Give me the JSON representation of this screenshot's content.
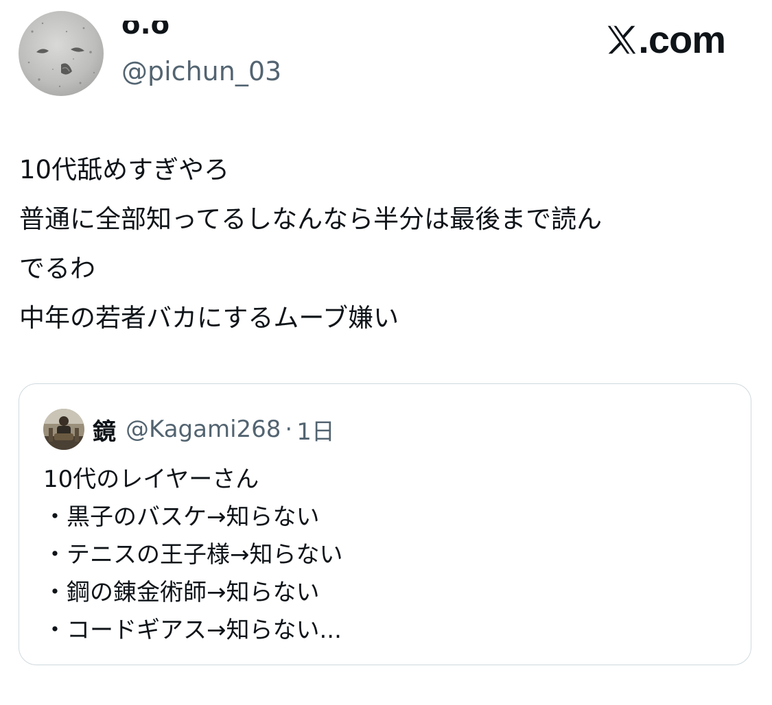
{
  "author": {
    "display_name": "o.o",
    "handle": "@pichun_03",
    "avatar_icon": "stone-face-avatar"
  },
  "site": {
    "brand_suffix": ".com",
    "logo_icon": "x-logo-icon"
  },
  "tweet": {
    "lines": [
      "10代舐めすぎやろ",
      "普通に全部知ってるしなんなら半分は最後まで読ん",
      "でるわ",
      "中年の若者バカにするムーブ嫌い"
    ]
  },
  "quote": {
    "name": "鏡",
    "handle": "@Kagami268",
    "separator": "·",
    "time": "1日",
    "avatar_icon": "person-photo-avatar",
    "lines": [
      "10代のレイヤーさん",
      "・黒子のバスケ→知らない",
      "・テニスの王子様→知らない",
      "・鋼の錬金術師→知らない",
      "・コードギアス→知らない..."
    ]
  },
  "colors": {
    "text_primary": "#0f1419",
    "text_secondary": "#536471",
    "border": "#cfd9de",
    "background": "#ffffff"
  }
}
